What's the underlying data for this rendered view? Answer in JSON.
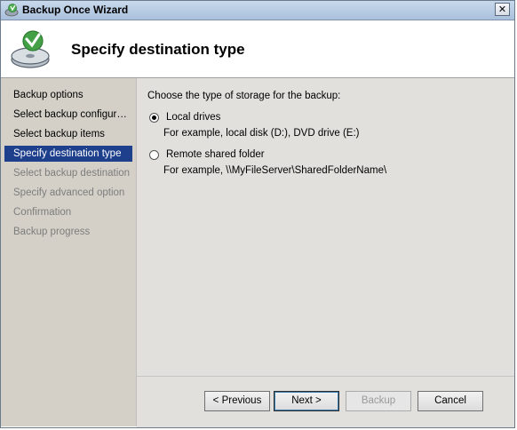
{
  "window": {
    "title": "Backup Once Wizard",
    "close_label": "✕"
  },
  "header": {
    "title": "Specify destination type"
  },
  "nav": {
    "items": [
      {
        "label": "Backup options",
        "state": "done"
      },
      {
        "label": "Select backup configur…",
        "state": "done"
      },
      {
        "label": "Select backup items",
        "state": "done"
      },
      {
        "label": "Specify destination type",
        "state": "current"
      },
      {
        "label": "Select backup destination",
        "state": "pending"
      },
      {
        "label": "Specify advanced option",
        "state": "pending"
      },
      {
        "label": "Confirmation",
        "state": "pending"
      },
      {
        "label": "Backup progress",
        "state": "pending"
      }
    ]
  },
  "content": {
    "prompt": "Choose the type of storage for the backup:",
    "options": [
      {
        "label": "Local drives",
        "example": "For example, local disk (D:), DVD drive (E:)",
        "checked": true
      },
      {
        "label": "Remote shared folder",
        "example": "For example, \\\\MyFileServer\\SharedFolderName\\",
        "checked": false
      }
    ]
  },
  "buttons": {
    "previous": "< Previous",
    "next": "Next >",
    "backup": "Backup",
    "cancel": "Cancel"
  },
  "colors": {
    "nav_selected": "#1e3f8c",
    "nav_background": "#d4d0c8",
    "content_background": "#e2e0dc"
  },
  "icons": {
    "app": "backup-icon",
    "header": "backup-disk-icon"
  }
}
